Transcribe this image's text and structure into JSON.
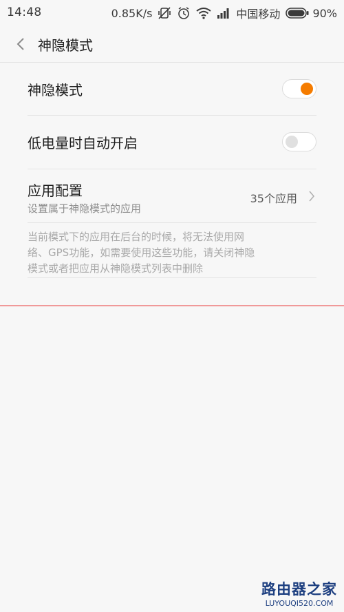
{
  "status_bar": {
    "time": "14:48",
    "speed": "0.85K/s",
    "carrier": "中国移动",
    "battery": "90%",
    "icons": [
      "vibrate-icon",
      "alarm-icon",
      "wifi-icon",
      "signal-icon",
      "battery-icon"
    ]
  },
  "header": {
    "back_icon": "chevron-left-icon",
    "title": "神隐模式"
  },
  "settings": [
    {
      "label": "神隐模式",
      "toggle": true
    },
    {
      "label": "低电量时自动开启",
      "toggle": false
    },
    {
      "label": "应用配置",
      "subtitle": "设置属于神隐模式的应用",
      "value": "35个应用"
    }
  ],
  "note": {
    "line1": "当前模式下的应用在后台的时候，将无法使用网",
    "line2": "络、GPS功能，如需要使用这些功能，请关闭神隐",
    "line3": "模式或者把应用从神隐模式列表中删除"
  },
  "watermark": {
    "name": "路由器之家",
    "url": "LUYOUQI520.COM"
  },
  "colors": {
    "accent": "#f57c00",
    "toggle_off_knob": "#e0e0e0",
    "divider_red": "#f09999"
  }
}
